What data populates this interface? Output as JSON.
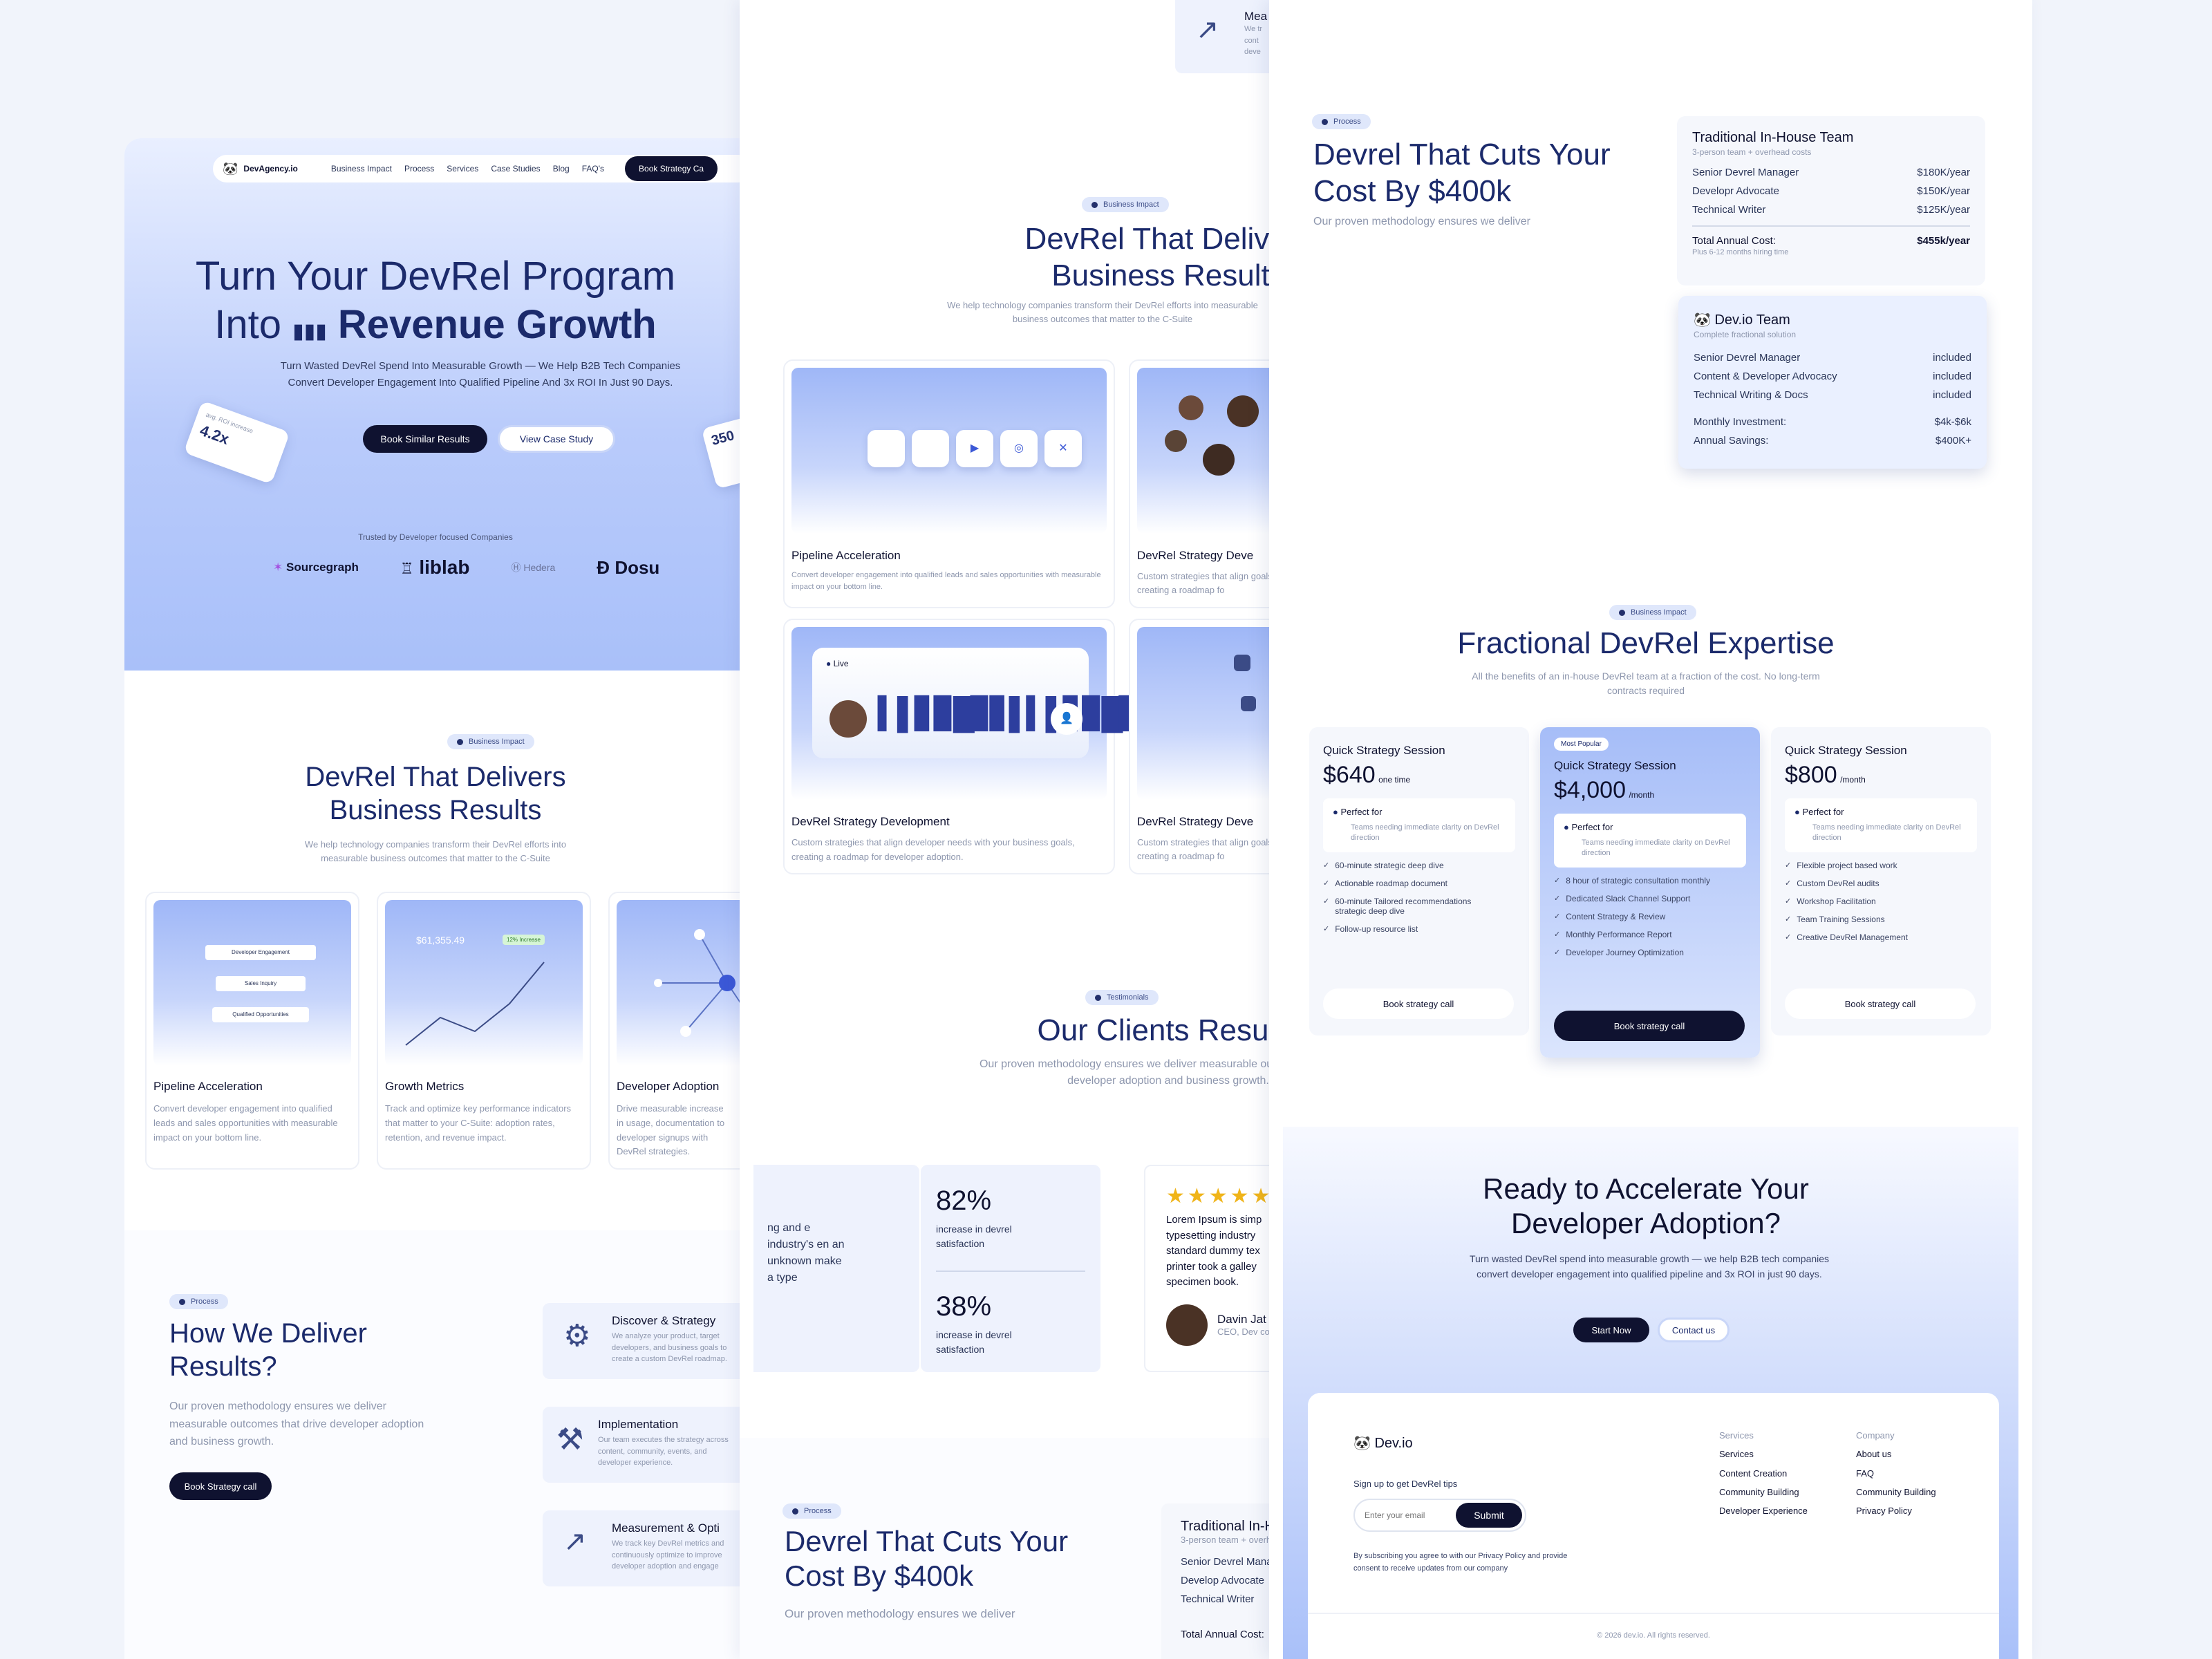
{
  "left": {
    "nav": {
      "logo": "DevAgency.io",
      "links": [
        "Business Impact",
        "Process",
        "Services",
        "Case Studies",
        "Blog",
        "FAQ's"
      ],
      "cta": "Book Strategy Ca"
    },
    "hero": {
      "title_line1": "Turn Your DevRel  Program",
      "title_into": "Into",
      "title_bold": "Revenue Growth",
      "subtitle": "Turn Wasted DevRel Spend Into Measurable Growth — We Help B2B Tech Companies Convert Developer Engagement Into Qualified Pipeline And 3x ROI In Just 90 Days.",
      "btn_primary": "Book Similar Results",
      "btn_secondary": "View Case Study",
      "float_stat": "4.2x",
      "float_stat_label": "avg. ROI increase",
      "float_right": "350",
      "trusted": "Trusted by Developer focused Companies",
      "logos": [
        "Sourcegraph",
        "liblab",
        "Hedera",
        "Dosu"
      ]
    },
    "impact": {
      "tag": "Business Impact",
      "title_line1": "DevRel That Delivers",
      "title_line2": "Business Results",
      "subtitle": "We help technology companies transform their DevRel efforts into measurable business outcomes that matter to the C-Suite",
      "cards": [
        {
          "title": "Pipeline Acceleration",
          "text": "Convert developer engagement into qualified leads and sales opportunities with measurable impact on your bottom line.",
          "mini": [
            "Developer Engagement",
            "Sales Inquiry",
            "Qualified Opportunities"
          ]
        },
        {
          "title": "Growth Metrics",
          "text": "Track and optimize key performance indicators that matter to your C-Suite: adoption rates, retention, and revenue impact.",
          "amount": "$61,355.49",
          "tag": "12% Increase"
        },
        {
          "title": "Developer Adoption",
          "text": "Drive measurable increase in usage, documentation to developer signups with DevRel strategies."
        }
      ]
    },
    "process": {
      "tag": "Process",
      "title_line1": "How We Deliver",
      "title_line2": "Results?",
      "subtitle": "Our proven methodology ensures we deliver measurable outcomes that drive developer adoption and business growth.",
      "cta": "Book Strategy call",
      "steps": [
        {
          "title": "Discover & Strategy",
          "text": "We analyze your product, target developers, and business goals to create a custom DevRel roadmap."
        },
        {
          "title": "Implementation",
          "text": "Our team executes the strategy across content, community, events, and developer experience."
        },
        {
          "title": "Measurement & Opti",
          "text": "We track key DevRel metrics and continuously optimize to improve developer adoption and engage"
        }
      ]
    }
  },
  "middle": {
    "top_card": {
      "title": "Mea",
      "text": "We tr cont deve"
    },
    "impact": {
      "tag": "Business Impact",
      "title_line1": "DevRel That Delivers",
      "title_line2": "Business Results",
      "subtitle": "We help technology companies transform their DevRel efforts into measurable business outcomes that matter to the C-Suite",
      "cards": [
        {
          "title": "Pipeline Acceleration",
          "text": "Convert developer engagement into qualified leads and sales opportunities with measurable impact on your bottom line."
        },
        {
          "title": "DevRel Strategy Deve",
          "text": "Custom strategies that align goals, creating a roadmap fo"
        },
        {
          "title": "DevRel Strategy Development",
          "text": "Custom strategies that align developer needs with your business goals, creating a roadmap for developer adoption.",
          "live": "Live"
        },
        {
          "title": "DevRel Strategy Deve",
          "text": "Custom strategies that align goals, creating a roadmap fo"
        }
      ]
    },
    "clients": {
      "tag": "Testimonials",
      "title": "Our Clients Results",
      "subtitle": "Our proven methodology ensures we deliver measurable outcomes that drive developer adoption and business growth.",
      "partial_text": "ng and e industry's en an unknown make a type",
      "stats": [
        {
          "value": "82%",
          "label": "increase in devrel satisfaction"
        },
        {
          "value": "38%",
          "label": "increase in devrel satisfaction"
        }
      ],
      "quote": "Lorem Ipsum is simp typesetting industry standard dummy tex printer took a galley specimen book.",
      "person": "Davin Jat",
      "role": "CEO, Dev co"
    },
    "cost": {
      "tag": "Process",
      "title_line1": "Devrel That Cuts Your",
      "title_line2": "Cost By $400k",
      "subtitle": "Our proven methodology ensures we deliver",
      "table_title": "Traditional In-H",
      "table_sub": "3-person team + overh",
      "rows": [
        "Senior Devrel Manag",
        "Develop Advocate",
        "Technical Writer"
      ],
      "total": "Total Annual Cost:"
    }
  },
  "right": {
    "cost": {
      "tag": "Process",
      "title_line1": "Devrel That Cuts Your",
      "title_line2": "Cost By $400k",
      "subtitle": "Our proven methodology ensures we deliver",
      "traditional": {
        "title": "Traditional In-House Team",
        "sub": "3-person team + overhead costs",
        "rows": [
          [
            "Senior Devrel Manager",
            "$180K/year"
          ],
          [
            "Developr Advocate",
            "$150K/year"
          ],
          [
            "Technical Writer",
            "$125K/year"
          ]
        ],
        "total_label": "Total Annual Cost:",
        "total_value": "$455k/year",
        "total_note": "Plus 6-12 months hiring time"
      },
      "devio": {
        "title": "Dev.io Team",
        "sub": "Complete fractional solution",
        "rows": [
          [
            "Senior Devrel Manager",
            "included"
          ],
          [
            "Content & Developer Advocacy",
            "included"
          ],
          [
            "Technical Writing & Docs",
            "included"
          ]
        ],
        "monthly_label": "Monthly Investment:",
        "monthly_value": "$4k-$6k",
        "savings_label": "Annual Savings:",
        "savings_value": "$400K+"
      }
    },
    "pricing": {
      "tag": "Business Impact",
      "title": "Fractional DevRel  Expertise",
      "subtitle": "All the benefits of an in-house DevRel team at a fraction of the cost.  No long-term contracts required",
      "plans": [
        {
          "name": "Quick Strategy Session",
          "price": "$640",
          "unit": "one time",
          "perfect": "Perfect for",
          "perfect_text": "Teams needing immediate clarity on DevRel direction",
          "features": [
            "60-minute strategic deep dive",
            "Actionable roadmap document",
            "60-minute Tailored recommendations strategic deep dive",
            "Follow-up resource list"
          ],
          "cta": "Book strategy call"
        },
        {
          "badge": "Most Popular",
          "name": "Quick Strategy Session",
          "price": "$4,000",
          "unit": "/month",
          "perfect": "Perfect for",
          "perfect_text": "Teams needing immediate clarity on DevRel direction",
          "features": [
            "8 hour of strategic consultation monthly",
            "Dedicated Slack Channel Support",
            "Content Strategy & Review",
            "Monthly Performance Report",
            "Developer Journey Optimization"
          ],
          "cta": "Book strategy call"
        },
        {
          "name": "Quick Strategy Session",
          "price": "$800",
          "unit": "/month",
          "perfect": "Perfect for",
          "perfect_text": "Teams needing immediate clarity on DevRel direction",
          "features": [
            "Flexible project based work",
            "Custom DevRel audits",
            "Workshop Facilitation",
            "Team Training Sessions",
            "Creative DevRel Management"
          ],
          "cta": "Book strategy call"
        }
      ]
    },
    "cta": {
      "title_line1": "Ready to Accelerate Your",
      "title_line2": "Developer Adoption?",
      "subtitle": "Turn wasted DevRel spend into measurable growth — we help B2B tech companies convert developer engagement into qualified pipeline and 3x ROI in just 90 days.",
      "btn_primary": "Start Now",
      "btn_secondary": "Contact us"
    },
    "footer": {
      "logo": "Dev.io",
      "signup": "Sign up to get DevRel tips",
      "email_placeholder": "Enter your email",
      "submit": "Submit",
      "consent": "By subscribing you agree to with our Privacy Policy and provide consent to receive updates from our company",
      "services_head": "Services",
      "services": [
        "Services",
        "Content Creation",
        "Community Building",
        "Developer Experience"
      ],
      "company_head": "Company",
      "company": [
        "About us",
        "FAQ",
        "Community Building",
        "Privacy Policy"
      ],
      "copyright": "© 2026 dev.io. All rights reserved."
    }
  }
}
